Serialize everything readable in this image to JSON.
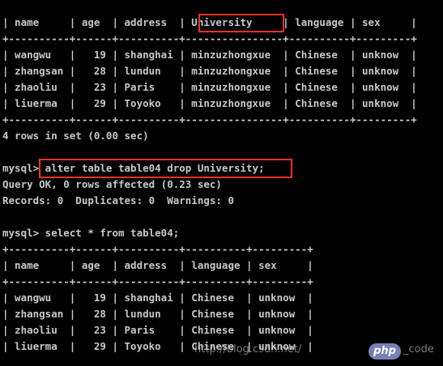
{
  "lines": [
    "| name     | age  | address  | University     | language | sex     |",
    "+----------+------+----------+----------------+----------+---------+",
    "| wangwu   |   19 | shanghai | minzuzhongxue  | Chinese  | unknow  |",
    "| zhangsan |   28 | lundun   | minzuzhongxue  | Chinese  | unknow  |",
    "| zhaoliu  |   23 | Paris    | minzuzhongxue  | Chinese  | unknow  |",
    "| liuerma  |   29 | Toyoko   | minzuzhongxue  | Chinese  | unknow  |",
    "+----------+------+----------+----------------+----------+---------+",
    "4 rows in set (0.00 sec)",
    "",
    "mysql> alter table table04 drop University;",
    "Query OK, 0 rows affected (0.23 sec)",
    "Records: 0  Duplicates: 0  Warnings: 0",
    "",
    "mysql> select * from table04;",
    "+----------+------+----------+----------+---------+",
    "| name     | age  | address  | language | sex     |",
    "+----------+------+----------+----------+---------+",
    "| wangwu   |   19 | shanghai | Chinese  | unknow  |",
    "| zhangsan |   28 | lundun   | Chinese  | unknow  |",
    "| zhaoliu  |   23 | Paris    | Chinese  | unknow  |",
    "| liuerma  |   29 | Toyoko   | Chinese  | unknow  |"
  ],
  "watermark": {
    "url_text": "http://blog.csdn.net/",
    "logo_text": "php",
    "suffix_text": "_code"
  },
  "highlight_color": "#e8322a"
}
